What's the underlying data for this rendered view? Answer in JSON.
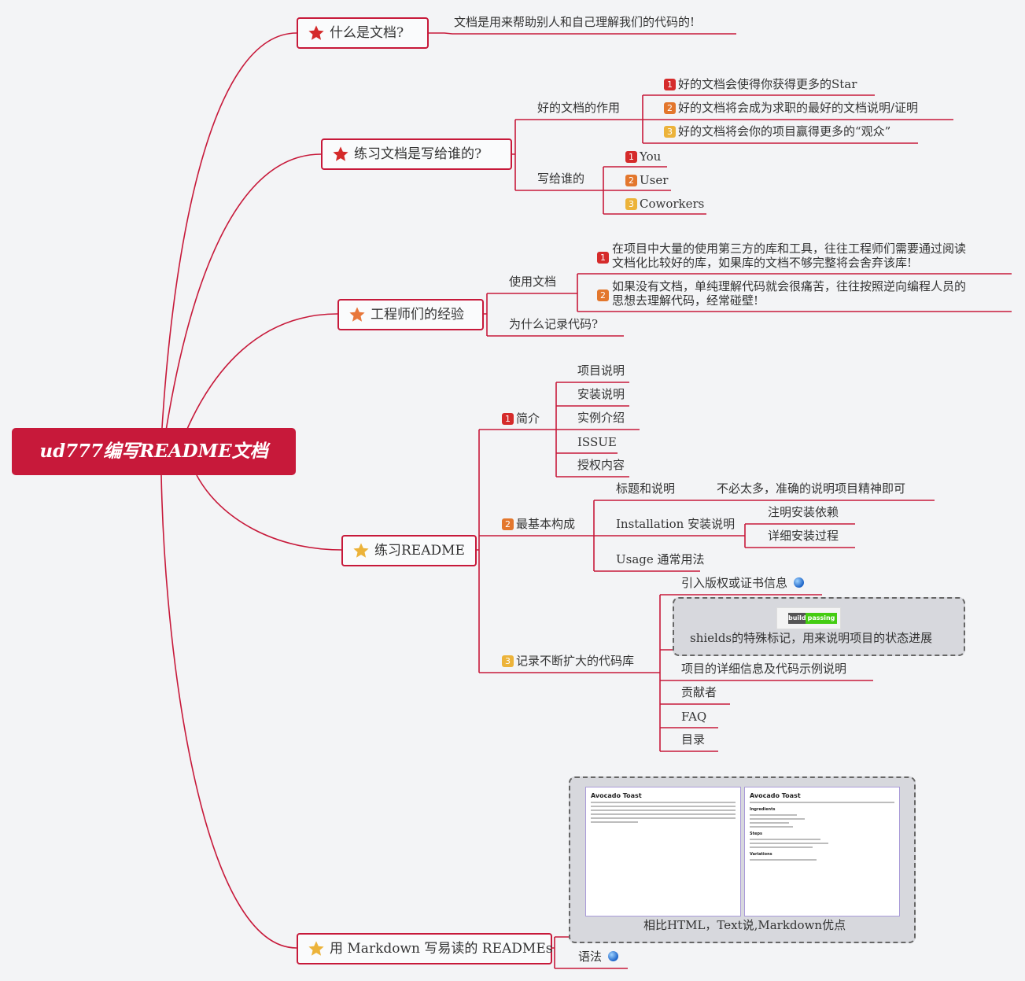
{
  "root": {
    "title": "ud777编写README文档"
  },
  "colors": {
    "accent": "#c7193a",
    "badge1": "#d52b2b",
    "badge2": "#e3772d",
    "badge3": "#ecb33a"
  },
  "topics": {
    "what": {
      "label": "什么是文档?",
      "desc": "文档是用来帮助别人和自己理解我们的代码的!"
    },
    "audience": {
      "label": "练习文档是写给谁的?",
      "good": {
        "label": "好的文档的作用",
        "items": [
          "好的文档会使得你获得更多的Star",
          "好的文档将会成为求职的最好的文档说明/证明",
          "好的文档将会你的项目赢得更多的“观众”"
        ]
      },
      "who": {
        "label": "写给谁的",
        "items": [
          "You",
          "User",
          "Coworkers"
        ]
      }
    },
    "experience": {
      "label": "工程师们的经验",
      "use": {
        "label": "使用文档",
        "item1_line1": "在项目中大量的使用第三方的库和工具，往往工程师们需要通过阅读",
        "item1_line2": "文档化比较好的库，如果库的文档不够完整将会舍弃该库!",
        "item2_line1": "如果没有文档，单纯理解代码就会很痛苦，往往按照逆向编程人员的",
        "item2_line2": "思想去理解代码，经常碰壁!"
      },
      "why": "为什么记录代码?"
    },
    "readme": {
      "label": "练习README",
      "intro": {
        "label": "简介",
        "items": [
          "项目说明",
          "安装说明",
          "实例介绍",
          "ISSUE",
          "授权内容"
        ]
      },
      "basic": {
        "label": "最基本构成",
        "title_label": "标题和说明",
        "title_desc": "不必太多，准确的说明项目精神即可",
        "install_label": "Installation 安装说明",
        "install_items": [
          "注明安装依赖",
          "详细安装过程"
        ],
        "usage_label": "Usage 通常用法"
      },
      "growing": {
        "label": "记录不断扩大的代码库",
        "license": "引入版权或证书信息",
        "shields": "shields的特殊标记，用来说明项目的状态进展",
        "badge_left": "build",
        "badge_right": "passing",
        "items": [
          "项目的详细信息及代码示例说明",
          "贡献者",
          "FAQ",
          "目录"
        ]
      }
    },
    "markdown": {
      "label": "用 Markdown 写易读的 READMEs",
      "compare": "相比HTML，Text说,Markdown优点",
      "syntax": "语法",
      "doc_left_title": "Avocado Toast",
      "doc_right_title": "Avocado Toast",
      "doc_right_sections": [
        "Ingredients",
        "Steps",
        "Variations"
      ]
    }
  }
}
